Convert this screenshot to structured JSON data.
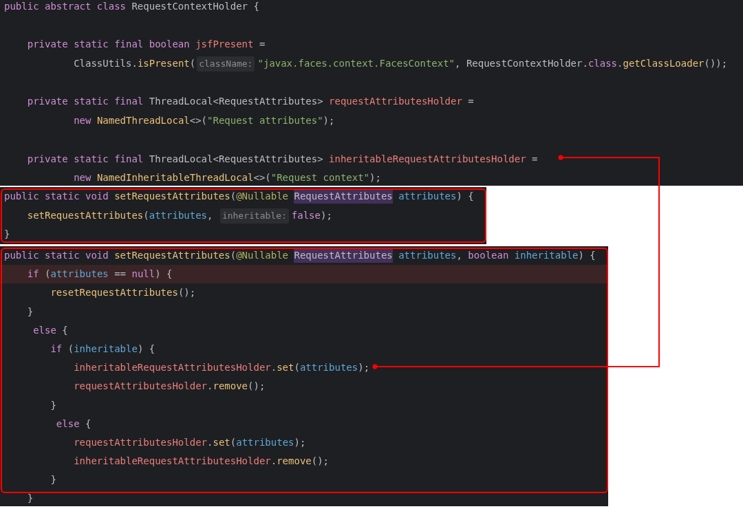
{
  "panels": [
    {
      "framed": false,
      "lines": [
        {
          "blank_line_before": false,
          "tokens": [
            {
              "text": "public abstract class ",
              "kind": "keyword"
            },
            {
              "text": "RequestContextHolder {",
              "kind": "plain"
            }
          ]
        },
        {
          "blank_line_before": true,
          "tokens": [
            {
              "text": "    private static final boolean ",
              "kind": "keyword"
            },
            {
              "text": "jsfPresent",
              "kind": "field"
            },
            {
              "text": " =",
              "kind": "plain"
            }
          ]
        },
        {
          "blank_line_before": false,
          "tokens": [
            {
              "text": "            ClassUtils.",
              "kind": "plain"
            },
            {
              "text": "isPresent",
              "kind": "method"
            },
            {
              "text": "(",
              "kind": "plain"
            },
            {
              "text": "className:",
              "kind": "hint"
            },
            {
              "text": "\"javax.faces.context.FacesContext\"",
              "kind": "string"
            },
            {
              "text": ", RequestContextHolder.",
              "kind": "plain"
            },
            {
              "text": "class.",
              "kind": "keyword"
            },
            {
              "text": "getClassLoader",
              "kind": "method"
            },
            {
              "text": "());",
              "kind": "plain"
            }
          ]
        },
        {
          "blank_line_before": true,
          "tokens": [
            {
              "text": "    private static final ",
              "kind": "keyword"
            },
            {
              "text": "ThreadLocal<RequestAttributes> ",
              "kind": "plain"
            },
            {
              "text": "requestAttributesHolder",
              "kind": "field"
            },
            {
              "text": " =",
              "kind": "plain"
            }
          ]
        },
        {
          "blank_line_before": false,
          "tokens": [
            {
              "text": "            new ",
              "kind": "keyword"
            },
            {
              "text": "NamedThreadLocal",
              "kind": "method"
            },
            {
              "text": "<>(",
              "kind": "plain"
            },
            {
              "text": "\"Request attributes\"",
              "kind": "string"
            },
            {
              "text": ");",
              "kind": "plain"
            }
          ]
        },
        {
          "blank_line_before": true,
          "tokens": [
            {
              "text": "    private static final ",
              "kind": "keyword"
            },
            {
              "text": "ThreadLocal<RequestAttributes> ",
              "kind": "plain"
            },
            {
              "text": "inheritableRequestAttributesHolder",
              "kind": "field"
            },
            {
              "text": " =",
              "kind": "plain"
            }
          ]
        },
        {
          "blank_line_before": false,
          "tokens": [
            {
              "text": "            new ",
              "kind": "keyword"
            },
            {
              "text": "NamedInheritableThreadLocal",
              "kind": "method"
            },
            {
              "text": "<>(",
              "kind": "plain"
            },
            {
              "text": "\"Request context\"",
              "kind": "string"
            },
            {
              "text": ");",
              "kind": "plain"
            }
          ]
        }
      ]
    },
    {
      "framed": true,
      "lines": [
        {
          "tokens": [
            {
              "text": "public static void ",
              "kind": "keyword"
            },
            {
              "text": "setRequestAttributes",
              "kind": "method"
            },
            {
              "text": "(",
              "kind": "plain"
            },
            {
              "text": "@Nullable ",
              "kind": "annotation"
            },
            {
              "text": "RequestAttributes",
              "kind": "match"
            },
            {
              "text": " attributes",
              "kind": "param"
            },
            {
              "text": ") {",
              "kind": "plain"
            }
          ]
        },
        {
          "tokens": [
            {
              "text": "    setRequestAttributes",
              "kind": "method"
            },
            {
              "text": "(",
              "kind": "plain"
            },
            {
              "text": "attributes",
              "kind": "param"
            },
            {
              "text": ", ",
              "kind": "plain"
            },
            {
              "text": "inheritable:",
              "kind": "hint"
            },
            {
              "text": "false",
              "kind": "keyword"
            },
            {
              "text": ");",
              "kind": "plain"
            }
          ]
        },
        {
          "tokens": [
            {
              "text": "}",
              "kind": "plain"
            }
          ]
        }
      ]
    },
    {
      "framed": true,
      "lines": [
        {
          "highlighted": false,
          "tokens": [
            {
              "text": "public static void ",
              "kind": "keyword"
            },
            {
              "text": "setRequestAttributes",
              "kind": "method"
            },
            {
              "text": "(",
              "kind": "plain"
            },
            {
              "text": "@Nullable ",
              "kind": "annotation"
            },
            {
              "text": "RequestAttributes",
              "kind": "match"
            },
            {
              "text": " attributes",
              "kind": "param"
            },
            {
              "text": ", ",
              "kind": "plain"
            },
            {
              "text": "boolean ",
              "kind": "keyword"
            },
            {
              "text": "inheritable",
              "kind": "param"
            },
            {
              "text": ") {",
              "kind": "plain"
            }
          ]
        },
        {
          "highlighted": true,
          "tokens": [
            {
              "text": "    if ",
              "kind": "keyword"
            },
            {
              "text": "(",
              "kind": "plain"
            },
            {
              "text": "attributes",
              "kind": "param"
            },
            {
              "text": " == ",
              "kind": "plain"
            },
            {
              "text": "null",
              "kind": "keyword"
            },
            {
              "text": ") {",
              "kind": "plain"
            }
          ]
        },
        {
          "highlighted": false,
          "tokens": [
            {
              "text": "        resetRequestAttributes",
              "kind": "method"
            },
            {
              "text": "();",
              "kind": "plain"
            }
          ]
        },
        {
          "highlighted": false,
          "tokens": [
            {
              "text": "    }",
              "kind": "plain"
            }
          ]
        },
        {
          "highlighted": false,
          "tokens": [
            {
              "text": "     else ",
              "kind": "keyword"
            },
            {
              "text": "{",
              "kind": "plain"
            }
          ]
        },
        {
          "highlighted": false,
          "tokens": [
            {
              "text": "        if ",
              "kind": "keyword"
            },
            {
              "text": "(",
              "kind": "plain"
            },
            {
              "text": "inheritable",
              "kind": "param"
            },
            {
              "text": ") {",
              "kind": "plain"
            }
          ]
        },
        {
          "highlighted": false,
          "tokens": [
            {
              "text": "            inheritableRequestAttributesHolder",
              "kind": "field"
            },
            {
              "text": ".",
              "kind": "plain"
            },
            {
              "text": "set",
              "kind": "method"
            },
            {
              "text": "(",
              "kind": "plain"
            },
            {
              "text": "attributes",
              "kind": "param"
            },
            {
              "text": ");",
              "kind": "plain"
            }
          ]
        },
        {
          "highlighted": false,
          "tokens": [
            {
              "text": "            requestAttributesHolder",
              "kind": "field"
            },
            {
              "text": ".",
              "kind": "plain"
            },
            {
              "text": "remove",
              "kind": "method"
            },
            {
              "text": "();",
              "kind": "plain"
            }
          ]
        },
        {
          "highlighted": false,
          "tokens": [
            {
              "text": "        }",
              "kind": "plain"
            }
          ]
        },
        {
          "highlighted": false,
          "tokens": [
            {
              "text": "         else ",
              "kind": "keyword"
            },
            {
              "text": "{",
              "kind": "plain"
            }
          ]
        },
        {
          "highlighted": false,
          "tokens": [
            {
              "text": "            requestAttributesHolder",
              "kind": "field"
            },
            {
              "text": ".",
              "kind": "plain"
            },
            {
              "text": "set",
              "kind": "method"
            },
            {
              "text": "(",
              "kind": "plain"
            },
            {
              "text": "attributes",
              "kind": "param"
            },
            {
              "text": ");",
              "kind": "plain"
            }
          ]
        },
        {
          "highlighted": false,
          "tokens": [
            {
              "text": "            inheritableRequestAttributesHolder",
              "kind": "field"
            },
            {
              "text": ".",
              "kind": "plain"
            },
            {
              "text": "remove",
              "kind": "method"
            },
            {
              "text": "();",
              "kind": "plain"
            }
          ]
        },
        {
          "highlighted": false,
          "tokens": [
            {
              "text": "        }",
              "kind": "plain"
            }
          ]
        },
        {
          "highlighted": false,
          "tokens": [
            {
              "text": "    }",
              "kind": "plain"
            }
          ]
        }
      ]
    }
  ]
}
